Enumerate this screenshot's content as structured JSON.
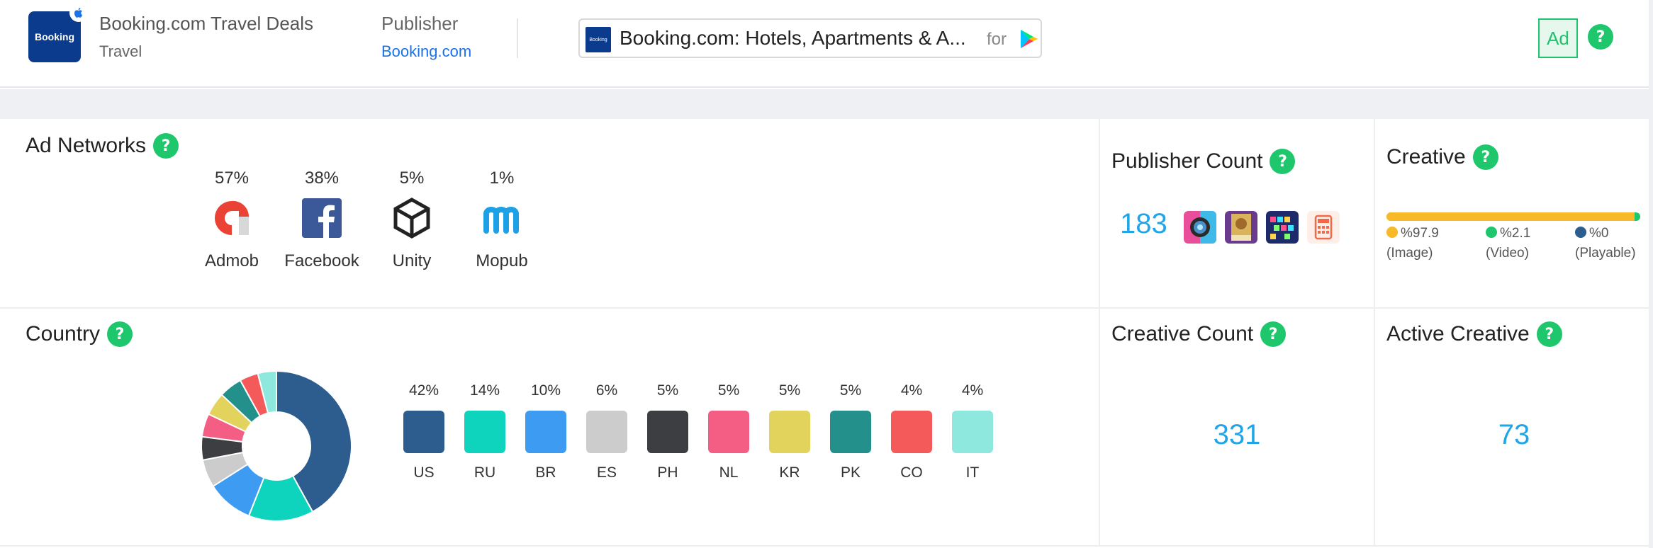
{
  "header": {
    "app_icon_text": "Booking",
    "app_title": "Booking.com Travel Deals",
    "app_category": "Travel",
    "publisher_label": "Publisher",
    "publisher_name": "Booking.com",
    "store_icon_text": "Booking",
    "store_title": "Booking.com: Hotels, Apartments & A...",
    "store_for": "for",
    "ad_badge": "Ad",
    "help": "?"
  },
  "ad_networks": {
    "title": "Ad Networks",
    "items": [
      {
        "pct": "57%",
        "name": "Admob"
      },
      {
        "pct": "38%",
        "name": "Facebook"
      },
      {
        "pct": "5%",
        "name": "Unity"
      },
      {
        "pct": "1%",
        "name": "Mopub"
      }
    ]
  },
  "publisher_count": {
    "title": "Publisher Count",
    "value": "183",
    "thumb_icons": [
      "camera-app-icon",
      "tarot-app-icon",
      "puzzle-app-icon",
      "calculator-app-icon"
    ]
  },
  "creative": {
    "title": "Creative",
    "legend": [
      {
        "value": "%97.9",
        "type": "(Image)",
        "color": "#f7b928"
      },
      {
        "value": "%2.1",
        "type": "(Video)",
        "color": "#1ec66c"
      },
      {
        "value": "%0",
        "type": "(Playable)",
        "color": "#2d5c8f"
      }
    ],
    "shares": [
      97.9,
      2.1,
      0
    ]
  },
  "country": {
    "title": "Country",
    "items": [
      {
        "pct": "42%",
        "code": "US",
        "color": "#2d5c8f"
      },
      {
        "pct": "14%",
        "code": "RU",
        "color": "#0fd4bd"
      },
      {
        "pct": "10%",
        "code": "BR",
        "color": "#3d9bf2"
      },
      {
        "pct": "6%",
        "code": "ES",
        "color": "#cccccc"
      },
      {
        "pct": "5%",
        "code": "PH",
        "color": "#3d3e42"
      },
      {
        "pct": "5%",
        "code": "NL",
        "color": "#f45e85"
      },
      {
        "pct": "5%",
        "code": "KR",
        "color": "#e2d35c"
      },
      {
        "pct": "5%",
        "code": "PK",
        "color": "#23908c"
      },
      {
        "pct": "4%",
        "code": "CO",
        "color": "#f55a5a"
      },
      {
        "pct": "4%",
        "code": "IT",
        "color": "#8fe8de"
      }
    ],
    "donut_values": [
      42,
      14,
      10,
      6,
      5,
      5,
      5,
      5,
      4,
      4
    ]
  },
  "creative_count": {
    "title": "Creative Count",
    "value": "331"
  },
  "active_creative": {
    "title": "Active Creative",
    "value": "73"
  }
}
